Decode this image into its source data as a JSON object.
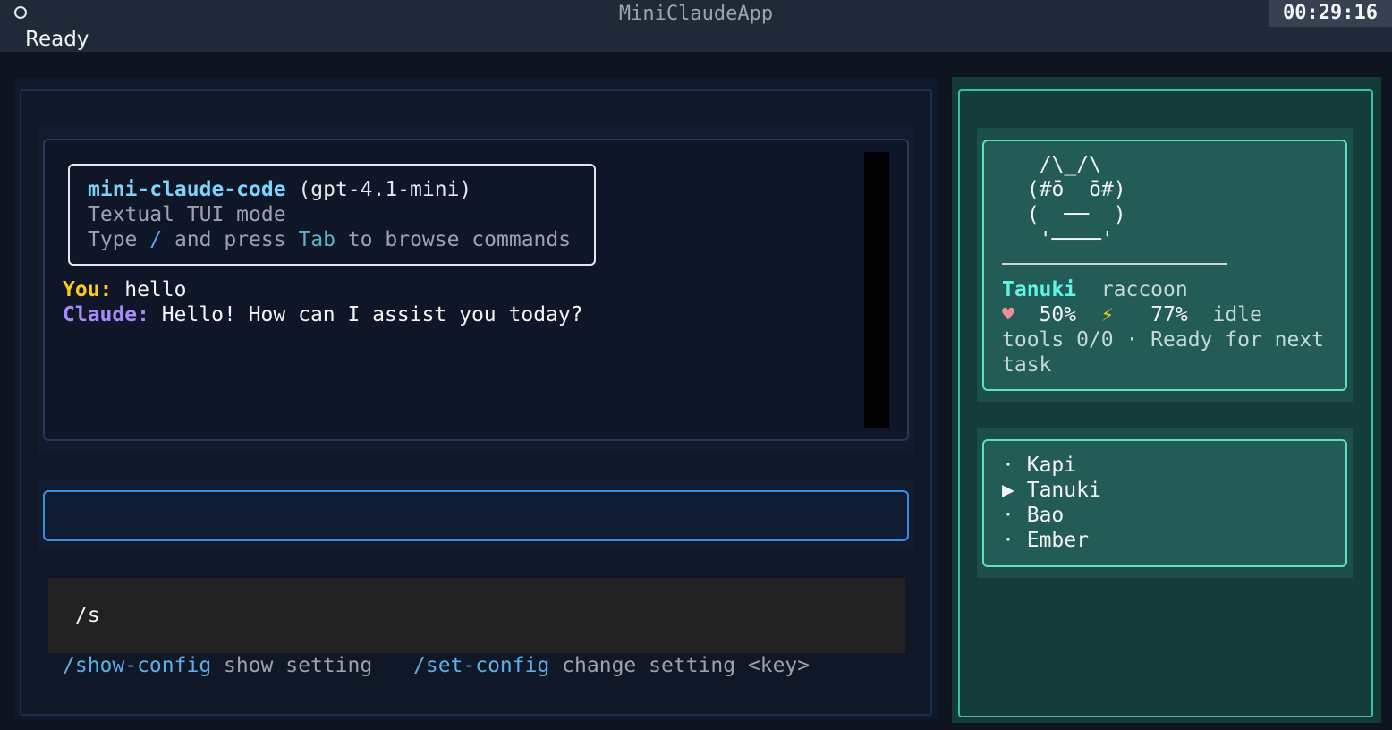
{
  "app": {
    "title": "MiniClaudeApp",
    "clock": "00:29:16",
    "status": "Ready"
  },
  "welcome": {
    "name": "mini-claude-code",
    "model": " (gpt-4.1-mini)",
    "mode": "Textual TUI mode",
    "hint_prefix": "Type ",
    "hint_slash": "/",
    "hint_middle": " and press ",
    "hint_tab": "Tab",
    "hint_suffix": " to browse commands"
  },
  "messages": [
    {
      "role": "You:",
      "text": " hello"
    },
    {
      "role": "Claude:",
      "text": " Hello! How can I assist you today?"
    }
  ],
  "input": {
    "value": ""
  },
  "command": {
    "query": "/s",
    "suggestions": [
      {
        "cmd": "/show-config",
        "desc": " show setting"
      },
      {
        "cmd": "/set-config",
        "desc": " change setting <key>"
      }
    ]
  },
  "pet": {
    "ascii": "  /\\_/\\\n (#ō  ō#)\n (  ──  )\n  '────'",
    "name": "Tanuki",
    "species": "raccoon",
    "heart_icon": "♥",
    "health": "50%",
    "bolt_icon": "⚡",
    "energy": "77%",
    "state": "idle",
    "tools_line": "tools 0/0 · Ready for next",
    "tools_line2": "task"
  },
  "pet_list": [
    {
      "marker": "·",
      "name": "Kapi"
    },
    {
      "marker": "▶",
      "name": "Tanuki"
    },
    {
      "marker": "·",
      "name": "Bao"
    },
    {
      "marker": "·",
      "name": "Ember"
    }
  ]
}
